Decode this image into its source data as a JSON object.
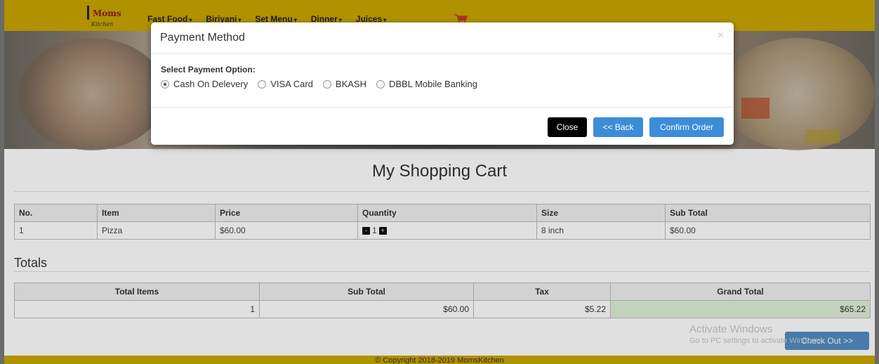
{
  "nav": {
    "logo_brand": "Moms",
    "logo_sub": "Kitchen",
    "links": [
      "Fast Food",
      "Biriyani",
      "Set Menu",
      "Dinner",
      "Juices"
    ],
    "caret": "▾",
    "cart_icon": "cart-icon"
  },
  "cart": {
    "title": "My Shopping Cart",
    "headers": [
      "No.",
      "Item",
      "Price",
      "Quantity",
      "Size",
      "Sub Total"
    ],
    "row": {
      "no": "1",
      "item": "Pizza",
      "price": "$60.00",
      "qty": "1",
      "minus": "-",
      "plus": "+",
      "size": "8 inch",
      "subtotal": "$60.00"
    }
  },
  "totals": {
    "title": "Totals",
    "headers": [
      "Total Items",
      "Sub Total",
      "Tax",
      "Grand Total"
    ],
    "values": [
      "1",
      "$60.00",
      "$5.22",
      "$65.22"
    ]
  },
  "checkout_label": "Check Out >>",
  "watermark": {
    "line1": "Activate Windows",
    "line2": "Go to PC settings to activate Windows."
  },
  "footer": "© Copyright 2018-2019 MomsKitchen",
  "modal": {
    "title": "Payment Method",
    "close_glyph": "×",
    "prompt": "Select Payment Option:",
    "options": [
      "Cash On Delevery",
      "VISA Card",
      "BKASH",
      "DBBL Mobile Banking"
    ],
    "selected": "Cash On Delevery",
    "buttons": {
      "close": "Close",
      "back": "<< Back",
      "confirm": "Confirm Order"
    }
  },
  "colors": {
    "nav": "#c9a600",
    "primary": "#3c8dd8",
    "grand_total_bg": "#dff0d8"
  }
}
